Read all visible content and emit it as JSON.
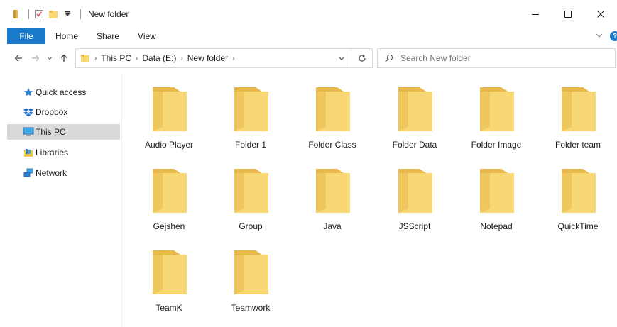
{
  "window": {
    "title": "New folder"
  },
  "ribbon": {
    "tabs": [
      {
        "label": "File"
      },
      {
        "label": "Home"
      },
      {
        "label": "Share"
      },
      {
        "label": "View"
      }
    ],
    "help": "?"
  },
  "address": {
    "crumbs": [
      "This PC",
      "Data (E:)",
      "New folder"
    ]
  },
  "search": {
    "placeholder": "Search New folder"
  },
  "nav_pane": {
    "items": [
      {
        "label": "Quick access",
        "icon": "star-icon"
      },
      {
        "label": "Dropbox",
        "icon": "dropbox-icon"
      },
      {
        "label": "This PC",
        "icon": "computer-icon",
        "selected": true
      },
      {
        "label": "Libraries",
        "icon": "libraries-icon"
      },
      {
        "label": "Network",
        "icon": "network-icon"
      }
    ]
  },
  "folders": [
    {
      "name": "Audio Player"
    },
    {
      "name": "Folder 1"
    },
    {
      "name": "Folder Class"
    },
    {
      "name": "Folder Data"
    },
    {
      "name": "Folder Image"
    },
    {
      "name": "Folder team"
    },
    {
      "name": "Gejshen"
    },
    {
      "name": "Group"
    },
    {
      "name": "Java"
    },
    {
      "name": "JSScript"
    },
    {
      "name": "Notepad"
    },
    {
      "name": "QuickTime"
    },
    {
      "name": "TeamK"
    },
    {
      "name": "Teamwork"
    }
  ],
  "colors": {
    "accent": "#1979ca",
    "folder_back": "#e8b94a",
    "folder_front": "#f8d775",
    "selected_nav": "#d9d9d9"
  }
}
